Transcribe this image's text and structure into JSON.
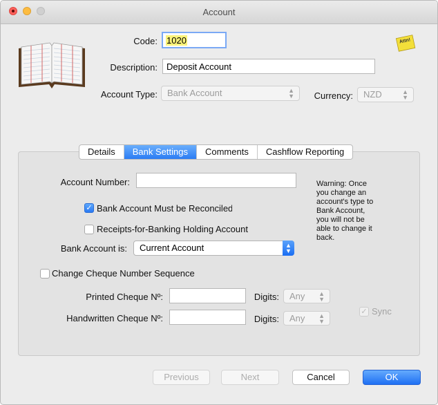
{
  "window": {
    "title": "Account"
  },
  "header": {
    "code_label": "Code:",
    "code_value": "1020",
    "description_label": "Description:",
    "description_value": "Deposit Account",
    "account_type_label": "Account Type:",
    "account_type_value": "Bank Account",
    "currency_label": "Currency:",
    "currency_value": "NZD",
    "note_icon_text": "Attn!"
  },
  "tabs": [
    "Details",
    "Bank Settings",
    "Comments",
    "Cashflow Reporting"
  ],
  "selected_tab": "Bank Settings",
  "bank_settings": {
    "account_number_label": "Account Number:",
    "account_number_value": "",
    "must_reconcile_label": "Bank Account Must be Reconciled",
    "must_reconcile_checked": true,
    "receipts_holding_label": "Receipts-for-Banking Holding Account",
    "receipts_holding_checked": false,
    "bank_account_is_label": "Bank Account is:",
    "bank_account_is_value": "Current Account",
    "warning_text": "Warning: Once you change an account's type to Bank Account, you will not be able to change it back.",
    "change_cheque_label": "Change Cheque Number Sequence",
    "change_cheque_checked": false,
    "printed_cheque_label": "Printed Cheque Nº:",
    "printed_cheque_value": "",
    "handwritten_cheque_label": "Handwritten Cheque Nº:",
    "handwritten_cheque_value": "",
    "digits_label": "Digits:",
    "printed_digits_value": "Any",
    "handwritten_digits_value": "Any",
    "sync_label": "Sync",
    "sync_checked": true
  },
  "footer": {
    "previous_label": "Previous",
    "next_label": "Next",
    "cancel_label": "Cancel",
    "ok_label": "OK"
  },
  "colors": {
    "accent": "#2b7cf4",
    "code_highlight": "#fbf37a"
  }
}
